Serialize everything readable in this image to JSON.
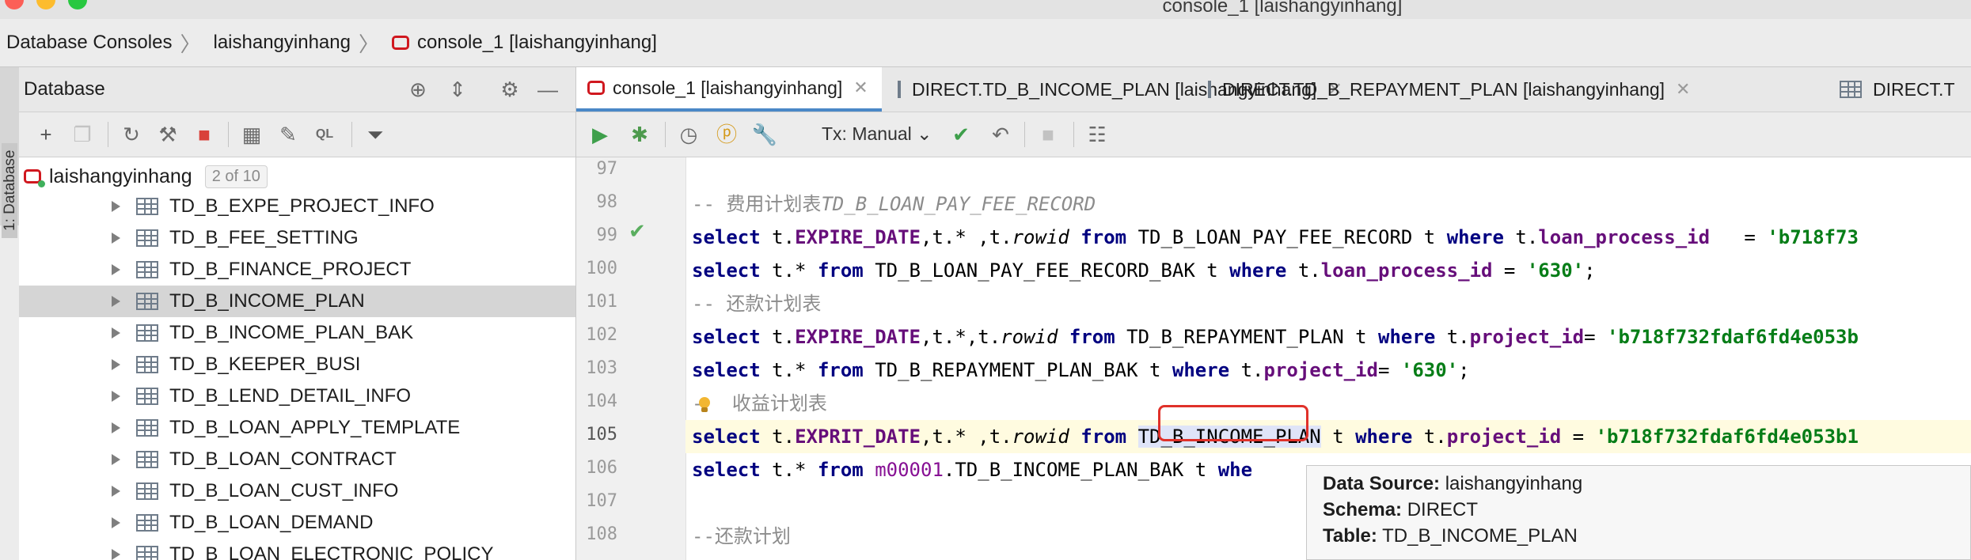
{
  "window": {
    "title": "console_1 [laishangyinhang]"
  },
  "breadcrumb": {
    "items": [
      "Database Consoles",
      "laishangyinhang",
      "console_1 [laishangyinhang]"
    ]
  },
  "sidestrip": {
    "label": "1: Database"
  },
  "db_panel": {
    "title": "Database",
    "root": {
      "label": "laishangyinhang",
      "badge": "2 of 10"
    },
    "tables": [
      "TD_B_EXPE_PROJECT_INFO",
      "TD_B_FEE_SETTING",
      "TD_B_FINANCE_PROJECT",
      "TD_B_INCOME_PLAN",
      "TD_B_INCOME_PLAN_BAK",
      "TD_B_KEEPER_BUSI",
      "TD_B_LEND_DETAIL_INFO",
      "TD_B_LOAN_APPLY_TEMPLATE",
      "TD_B_LOAN_CONTRACT",
      "TD_B_LOAN_CUST_INFO",
      "TD_B_LOAN_DEMAND",
      "TD_B_LOAN_ELECTRONIC_POLICY"
    ],
    "selected_table": "TD_B_INCOME_PLAN"
  },
  "tabs": [
    {
      "label": "console_1 [laishangyinhang]",
      "active": true
    },
    {
      "label": "DIRECT.TD_B_INCOME_PLAN [laishangyinhang]",
      "active": false
    },
    {
      "label": "DIRECT.TD_B_REPAYMENT_PLAN [laishangyinhang]",
      "active": false
    },
    {
      "label": "DIRECT.T",
      "active": false
    }
  ],
  "editor_toolbar": {
    "tx_mode": "Tx: Manual"
  },
  "editor": {
    "line_numbers": [
      "97",
      "98",
      "99",
      "100",
      "101",
      "102",
      "103",
      "104",
      "105",
      "106",
      "107",
      "108"
    ],
    "current_line": "105",
    "lines": {
      "l98_prefix": "-- 费用计划表",
      "l98_table": "TD_B_LOAN_PAY_FEE_RECORD",
      "l99": {
        "a": "select",
        "b": " t.",
        "c": "EXPIRE_DATE",
        "d": ",t.* ,t.",
        "e": "rowid",
        "f": " from ",
        "g": "TD_B_LOAN_PAY_FEE_RECORD t ",
        "h": "where",
        "i": " t.",
        "j": "loan_process_id",
        "k": "   = ",
        "l": "'b718f73"
      },
      "l100": {
        "a": "select",
        "b": " t.* ",
        "c": "from",
        "d": " TD_B_LOAN_PAY_FEE_RECORD_BAK t ",
        "e": "where",
        "f": " t.",
        "g": "loan_process_id",
        "h": " = ",
        "i": "'630'",
        "j": ";"
      },
      "l101": "-- 还款计划表",
      "l102": {
        "a": "select",
        "b": " t.",
        "c": "EXPIRE_DATE",
        "d": ",t.*,t.",
        "e": "rowid",
        "f": " from ",
        "g": "TD_B_REPAYMENT_PLAN t ",
        "h": "where",
        "i": " t.",
        "j": "project_id",
        "k": "= ",
        "l": "'b718f732fdaf6fd4e053b"
      },
      "l103": {
        "a": "select",
        "b": " t.* ",
        "c": "from",
        "d": " TD_B_REPAYMENT_PLAN_BAK t ",
        "e": "where",
        "f": " t.",
        "g": "project_id",
        "h": "= ",
        "i": "'630'",
        "j": ";"
      },
      "l104_dash": "-",
      "l104_text": " 收益计划表",
      "l105": {
        "a": "select",
        "b": " t.",
        "c": "EXPRIT_DATE",
        "d": ",t.* ,t.",
        "e": "rowid",
        "f": " from ",
        "g": "TD_B_INCOME_PLAN",
        "h": " t ",
        "i": "where",
        "j": " t.",
        "k": "project_id",
        "l": " = ",
        "m": "'b718f732fdaf6fd4e053b1"
      },
      "l106": {
        "a": "select",
        "b": " t.* ",
        "c": "from",
        "d": " ",
        "e": "m00001",
        "f": ".TD_B_INCOME_PLAN_BAK t ",
        "g": "whe"
      },
      "l108": "--还款计划"
    }
  },
  "tooltip": {
    "data_source_label": "Data Source:",
    "data_source_value": "laishangyinhang",
    "schema_label": "Schema:",
    "schema_value": "DIRECT",
    "table_label": "Table:",
    "table_value": "TD_B_INCOME_PLAN"
  },
  "colors": {
    "keyword": "#000080",
    "field": "#660e7a",
    "string": "#067d17",
    "comment": "#8c8c8c",
    "highlight_box": "#e0312a",
    "current_line": "#fffbe0"
  }
}
